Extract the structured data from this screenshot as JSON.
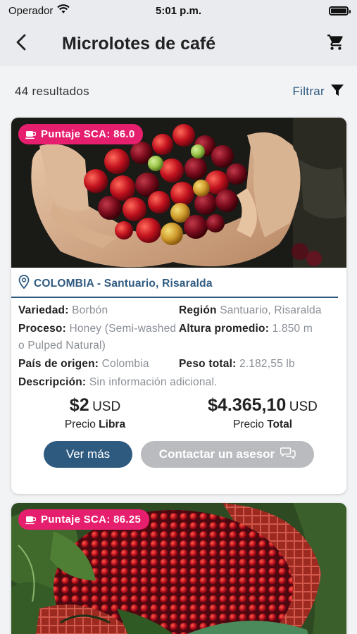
{
  "status_bar": {
    "carrier": "Operador",
    "time": "5:01 p.m.",
    "battery_level": 1.0
  },
  "nav": {
    "title": "Microlotes de café",
    "back_icon": "chevron-left-icon",
    "cart_icon": "cart-icon"
  },
  "results": {
    "count_label": "44 resultados",
    "filter_label": "Filtrar",
    "filter_icon": "funnel-icon"
  },
  "colors": {
    "accent": "#2f5a80",
    "badge": "#e61e6e",
    "disabled_button": "#b9bbbe"
  },
  "cards": [
    {
      "sca_badge": "Puntaje SCA: 86.0",
      "location": "COLOMBIA - Santuario, Risaralda",
      "variety_label": "Variedad:",
      "variety_value": "Borbón",
      "region_label": "Región",
      "region_value": "Santuario, Risaralda",
      "process_label": "Proceso:",
      "process_value": "Honey (Semi-washed o Pulped Natural)",
      "altitude_label": "Altura promedio:",
      "altitude_value": "1.850 m",
      "origin_label": "País de origen:",
      "origin_value": "Colombia",
      "weight_label": "Peso total:",
      "weight_value": "2.182,55 lb",
      "description_label": "Descripción:",
      "description_value": "Sin información adicional.",
      "price_per_lb": "$2",
      "price_per_lb_currency": "USD",
      "price_per_lb_caption_prefix": "Precio",
      "price_per_lb_caption_bold": "Libra",
      "price_total": "$4.365,10",
      "price_total_currency": "USD",
      "price_total_caption_prefix": "Precio",
      "price_total_caption_bold": "Total",
      "more_button": "Ver más",
      "contact_button": "Contactar un asesor"
    },
    {
      "sca_badge": "Puntaje SCA: 86.25"
    }
  ]
}
